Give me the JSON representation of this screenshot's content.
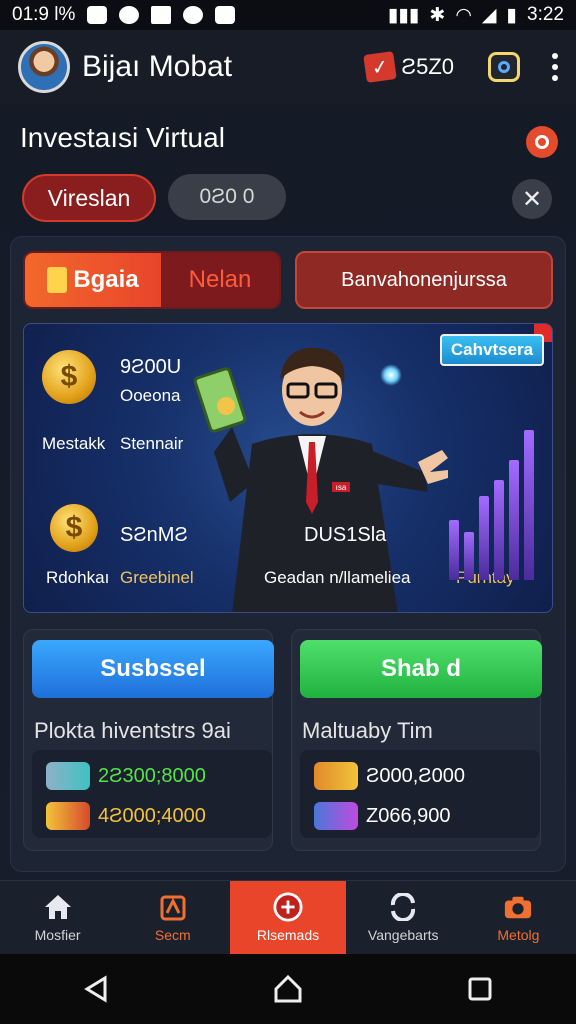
{
  "status_bar": {
    "time_left": "01:9 l%",
    "time_right": "3:22"
  },
  "app": {
    "name": "Bijaı Mobat",
    "coins": "Ƨ5Z0"
  },
  "page": {
    "title": "Investaısi Virtual",
    "pill_active": "Vireslan",
    "pill_value": "0Ƨ0 0"
  },
  "tabs": {
    "left_a": "Bgaia",
    "left_b": "Nelan",
    "right": "Banvahonenjurssa"
  },
  "hero": {
    "badge": "Cahvtsera",
    "v1": "9Ƨ00U",
    "v1_label": "Ooeona",
    "l1": "Mestakk",
    "l2": "Stennair",
    "v2": "SƧnMƧ",
    "l3": "Rdohkaı",
    "l4": "Greebinel",
    "v3": "DUS1Sla",
    "l5": "Geadan n/llameliea",
    "l6": "Purntay",
    "man_badge": "ısa"
  },
  "cards": {
    "left": {
      "button": "Susbssel",
      "title": "Plokta hiventstrs 9ai",
      "row1": "2Ƨ300;8000",
      "row2": "4Ƨ000;4000"
    },
    "right": {
      "button": "Shab d",
      "title": "Maltuaby Tim",
      "row1": "Ƨ000,Ƨ000",
      "row2": "Z066,900"
    }
  },
  "bottom_tabs": [
    {
      "label": "Mosfier",
      "icon": "home-icon"
    },
    {
      "label": "Secm",
      "icon": "bank-icon"
    },
    {
      "label": "Rlsemads",
      "icon": "plus-circle-icon"
    },
    {
      "label": "Vangebarts",
      "icon": "refresh-icon"
    },
    {
      "label": "Metolg",
      "icon": "camera-icon"
    }
  ],
  "colors": {
    "accent": "#e8452b",
    "blue": "#2b8bef",
    "green": "#3cd45a",
    "bg": "#121722"
  }
}
